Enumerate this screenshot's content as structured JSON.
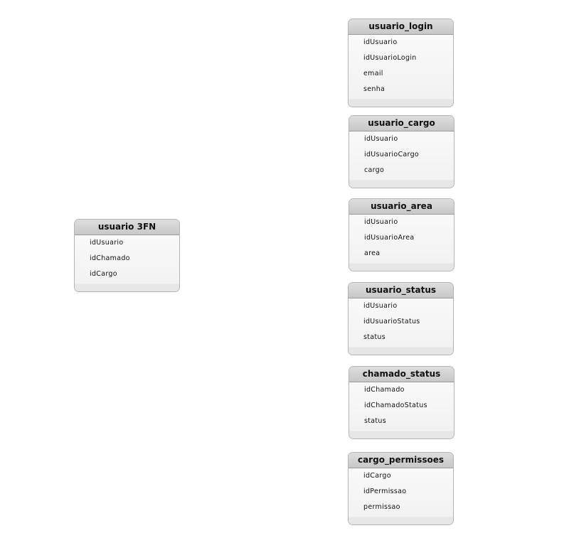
{
  "entities": [
    {
      "id": "usuario_3fn",
      "name": "usuario 3FN",
      "fields": [
        "idUsuario",
        "idChamado",
        "idCargo"
      ]
    },
    {
      "id": "usuario_login",
      "name": "usuario_login",
      "fields": [
        "idUsuario",
        "idUsuarioLogin",
        "email",
        "senha"
      ]
    },
    {
      "id": "usuario_cargo",
      "name": "usuario_cargo",
      "fields": [
        "idUsuario",
        "idUsuarioCargo",
        "cargo"
      ]
    },
    {
      "id": "usuario_area",
      "name": "usuario_area",
      "fields": [
        "idUsuario",
        "idUsuarioArea",
        "area"
      ]
    },
    {
      "id": "usuario_status",
      "name": "usuario_status",
      "fields": [
        "idUsuario",
        "idUsuarioStatus",
        "status"
      ]
    },
    {
      "id": "chamado_status",
      "name": "chamado_status",
      "fields": [
        "idChamado",
        "idChamadoStatus",
        "status"
      ]
    },
    {
      "id": "cargo_permissoes",
      "name": "cargo_permissoes",
      "fields": [
        "idCargo",
        "idPermissao",
        "permissao"
      ]
    }
  ]
}
